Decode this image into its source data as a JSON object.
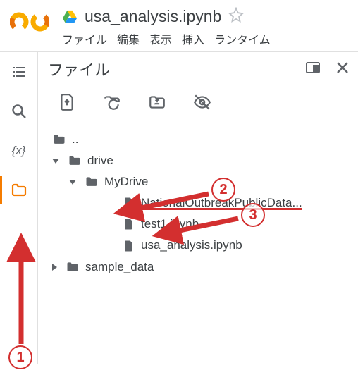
{
  "header": {
    "doc_title": "usa_analysis.ipynb",
    "menu": {
      "file": "ファイル",
      "edit": "編集",
      "view": "表示",
      "insert": "挿入",
      "runtime": "ランタイム"
    }
  },
  "panel": {
    "title": "ファイル"
  },
  "tree": {
    "parent": "..",
    "drive": "drive",
    "mydrive": "MyDrive",
    "file1": "NationalOutbreakPublicData...",
    "file2": "test1.ipynb",
    "file3": "usa_analysis.ipynb",
    "sample": "sample_data"
  },
  "annotations": {
    "n1": "1",
    "n2": "2",
    "n3": "3"
  },
  "icons": {
    "colab": "colab-logo",
    "drive": "drive-logo",
    "star": "star-icon",
    "toc": "toc-icon",
    "search": "search-icon",
    "vars": "variables-icon",
    "files": "files-icon",
    "newwin": "open-window-icon",
    "close": "close-icon",
    "upload": "upload-icon",
    "refresh": "refresh-folder-icon",
    "mount": "mount-drive-icon",
    "hidden": "toggle-hidden-icon"
  }
}
